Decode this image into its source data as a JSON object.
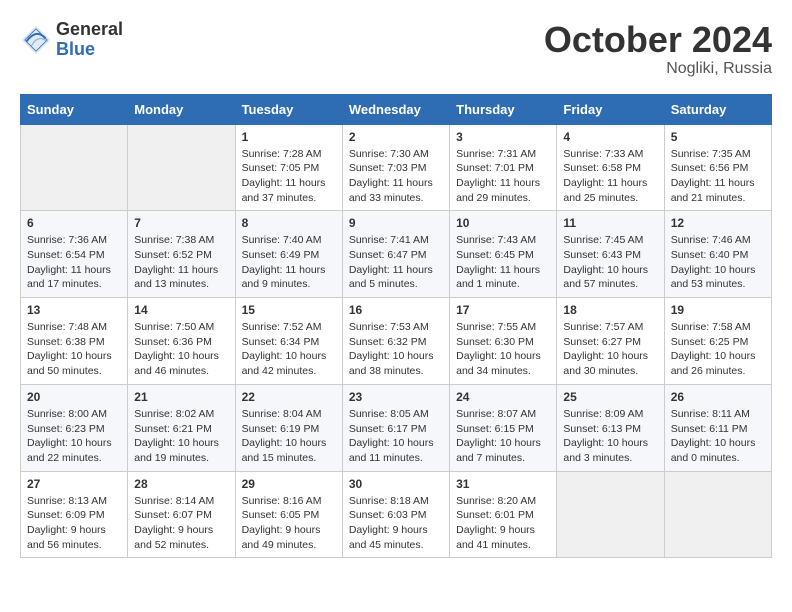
{
  "header": {
    "logo_general": "General",
    "logo_blue": "Blue",
    "month_title": "October 2024",
    "location": "Nogliki, Russia"
  },
  "weekdays": [
    "Sunday",
    "Monday",
    "Tuesday",
    "Wednesday",
    "Thursday",
    "Friday",
    "Saturday"
  ],
  "weeks": [
    [
      {
        "day": "",
        "info": ""
      },
      {
        "day": "",
        "info": ""
      },
      {
        "day": "1",
        "info": "Sunrise: 7:28 AM\nSunset: 7:05 PM\nDaylight: 11 hours and 37 minutes."
      },
      {
        "day": "2",
        "info": "Sunrise: 7:30 AM\nSunset: 7:03 PM\nDaylight: 11 hours and 33 minutes."
      },
      {
        "day": "3",
        "info": "Sunrise: 7:31 AM\nSunset: 7:01 PM\nDaylight: 11 hours and 29 minutes."
      },
      {
        "day": "4",
        "info": "Sunrise: 7:33 AM\nSunset: 6:58 PM\nDaylight: 11 hours and 25 minutes."
      },
      {
        "day": "5",
        "info": "Sunrise: 7:35 AM\nSunset: 6:56 PM\nDaylight: 11 hours and 21 minutes."
      }
    ],
    [
      {
        "day": "6",
        "info": "Sunrise: 7:36 AM\nSunset: 6:54 PM\nDaylight: 11 hours and 17 minutes."
      },
      {
        "day": "7",
        "info": "Sunrise: 7:38 AM\nSunset: 6:52 PM\nDaylight: 11 hours and 13 minutes."
      },
      {
        "day": "8",
        "info": "Sunrise: 7:40 AM\nSunset: 6:49 PM\nDaylight: 11 hours and 9 minutes."
      },
      {
        "day": "9",
        "info": "Sunrise: 7:41 AM\nSunset: 6:47 PM\nDaylight: 11 hours and 5 minutes."
      },
      {
        "day": "10",
        "info": "Sunrise: 7:43 AM\nSunset: 6:45 PM\nDaylight: 11 hours and 1 minute."
      },
      {
        "day": "11",
        "info": "Sunrise: 7:45 AM\nSunset: 6:43 PM\nDaylight: 10 hours and 57 minutes."
      },
      {
        "day": "12",
        "info": "Sunrise: 7:46 AM\nSunset: 6:40 PM\nDaylight: 10 hours and 53 minutes."
      }
    ],
    [
      {
        "day": "13",
        "info": "Sunrise: 7:48 AM\nSunset: 6:38 PM\nDaylight: 10 hours and 50 minutes."
      },
      {
        "day": "14",
        "info": "Sunrise: 7:50 AM\nSunset: 6:36 PM\nDaylight: 10 hours and 46 minutes."
      },
      {
        "day": "15",
        "info": "Sunrise: 7:52 AM\nSunset: 6:34 PM\nDaylight: 10 hours and 42 minutes."
      },
      {
        "day": "16",
        "info": "Sunrise: 7:53 AM\nSunset: 6:32 PM\nDaylight: 10 hours and 38 minutes."
      },
      {
        "day": "17",
        "info": "Sunrise: 7:55 AM\nSunset: 6:30 PM\nDaylight: 10 hours and 34 minutes."
      },
      {
        "day": "18",
        "info": "Sunrise: 7:57 AM\nSunset: 6:27 PM\nDaylight: 10 hours and 30 minutes."
      },
      {
        "day": "19",
        "info": "Sunrise: 7:58 AM\nSunset: 6:25 PM\nDaylight: 10 hours and 26 minutes."
      }
    ],
    [
      {
        "day": "20",
        "info": "Sunrise: 8:00 AM\nSunset: 6:23 PM\nDaylight: 10 hours and 22 minutes."
      },
      {
        "day": "21",
        "info": "Sunrise: 8:02 AM\nSunset: 6:21 PM\nDaylight: 10 hours and 19 minutes."
      },
      {
        "day": "22",
        "info": "Sunrise: 8:04 AM\nSunset: 6:19 PM\nDaylight: 10 hours and 15 minutes."
      },
      {
        "day": "23",
        "info": "Sunrise: 8:05 AM\nSunset: 6:17 PM\nDaylight: 10 hours and 11 minutes."
      },
      {
        "day": "24",
        "info": "Sunrise: 8:07 AM\nSunset: 6:15 PM\nDaylight: 10 hours and 7 minutes."
      },
      {
        "day": "25",
        "info": "Sunrise: 8:09 AM\nSunset: 6:13 PM\nDaylight: 10 hours and 3 minutes."
      },
      {
        "day": "26",
        "info": "Sunrise: 8:11 AM\nSunset: 6:11 PM\nDaylight: 10 hours and 0 minutes."
      }
    ],
    [
      {
        "day": "27",
        "info": "Sunrise: 8:13 AM\nSunset: 6:09 PM\nDaylight: 9 hours and 56 minutes."
      },
      {
        "day": "28",
        "info": "Sunrise: 8:14 AM\nSunset: 6:07 PM\nDaylight: 9 hours and 52 minutes."
      },
      {
        "day": "29",
        "info": "Sunrise: 8:16 AM\nSunset: 6:05 PM\nDaylight: 9 hours and 49 minutes."
      },
      {
        "day": "30",
        "info": "Sunrise: 8:18 AM\nSunset: 6:03 PM\nDaylight: 9 hours and 45 minutes."
      },
      {
        "day": "31",
        "info": "Sunrise: 8:20 AM\nSunset: 6:01 PM\nDaylight: 9 hours and 41 minutes."
      },
      {
        "day": "",
        "info": ""
      },
      {
        "day": "",
        "info": ""
      }
    ]
  ]
}
